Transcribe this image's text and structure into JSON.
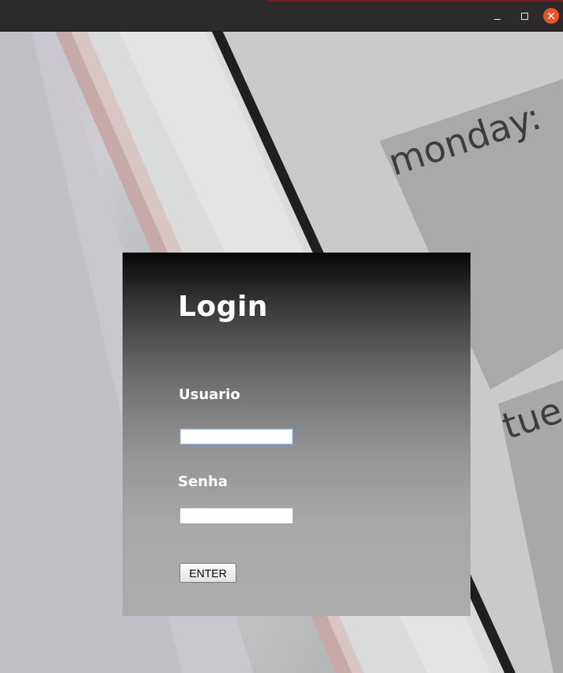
{
  "window": {
    "controls": [
      "minimize-icon",
      "maximize-icon",
      "close-icon"
    ],
    "close_color": "#e95420"
  },
  "background": {
    "text_1": "monday:",
    "text_2": "tue"
  },
  "login": {
    "title": "Login",
    "user_label": "Usuario",
    "user_value": "",
    "pass_label": "Senha",
    "pass_value": "",
    "enter_label": "ENTER"
  }
}
